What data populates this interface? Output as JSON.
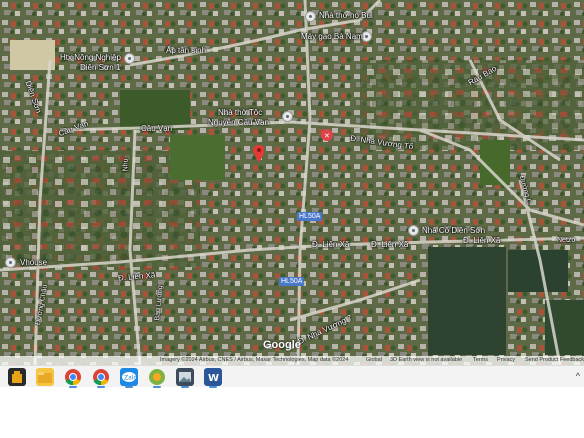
{
  "map": {
    "labels": {
      "nha_tho_ho_bui": "Nhà thờ họ Bùi",
      "may_gao_ba_nam": "Máy gạo Bà Nam",
      "ap_tan_sinh": "Ấp tân sinh",
      "htx_nong_nghiep": "Htx Nông Nghiệp",
      "dien_son_1": "Diên Sơn 1",
      "dien_son_road": "Diên Sơn",
      "cau_van_1": "Cầu Vạn",
      "cau_van_2": "Cầu Vạn",
      "nha_tho_toc": "Nhà thờ Tộc",
      "nguyen_cau_van": "Nguyễn Cầu Vạn",
      "d_nha_vuong_to": "Đ. Nhà Vương Tổ",
      "d_lien_xa_1": "Đ. Liên Xã",
      "d_lien_xa_2": "Đ. Liên Xã",
      "d_lien_xa_3": "Đ. Liên Xã",
      "d_lien_xa_4": "Đ. Liên Xã",
      "nha_co_dien_son": "Nhà Cổ Diên Sơn",
      "nha_vuong_7": "Đ. Nhà Vương 7",
      "vhouse": "Vhouse",
      "duong_chau": "Đường Châu",
      "bau_luong": "Bàu Lương",
      "nhu": "Nhu",
      "duong_c": "Đường C",
      "netzo": "Netzo",
      "rau_bao": "Rau Bao"
    },
    "shields": {
      "hl50a_1": "HL50A",
      "hl50a_2": "HL50A"
    },
    "attribution": "Imagery ©2024 Airbus, CNES / Airbus, Maxar Technologies, Map data ©2024",
    "footer_links": [
      "Global",
      "3D Earth view is not available",
      "Terms",
      "Privacy",
      "Send Product Feedback"
    ],
    "google_logo": "Google"
  },
  "taskbar": {
    "icons": [
      "start-icon",
      "file-explorer-icon",
      "chrome-icon",
      "chrome-icon-2",
      "zalo-icon",
      "app-icon",
      "photos-icon",
      "word-icon"
    ],
    "tray": "^"
  }
}
